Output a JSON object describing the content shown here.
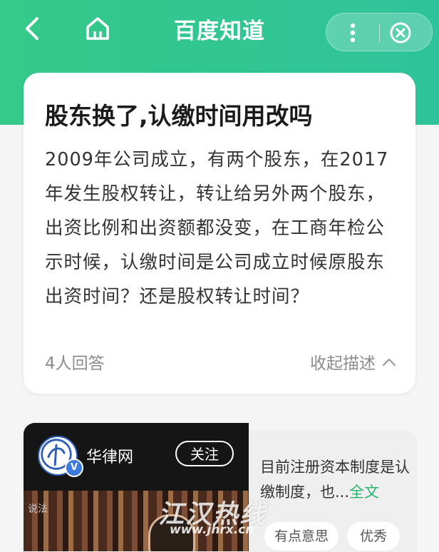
{
  "header": {
    "title": "百度知道",
    "back_icon": "chevron-left-icon",
    "home_icon": "home-icon",
    "more_icon": "more-vertical-icon",
    "close_icon": "close-circle-icon"
  },
  "question": {
    "title": "股东换了,认缴时间用改吗",
    "description": "2009年公司成立，有两个股东，在2017年发生股权转让，转让给另外两个股东，出资比例和出资额都没变，在工商年检公示时候，认缴时间是公司成立时候原股东出资时间？还是股权转让时间？",
    "answer_count": "4人回答",
    "collapse_label": "收起描述"
  },
  "video": {
    "source_name": "华律网",
    "follow_label": "关注",
    "verified_badge": "V",
    "shelf_label": "说法"
  },
  "answer_preview": {
    "text": "目前注册资本制度是认缴制度，也...",
    "full_link": "全文",
    "tags": [
      "有点意思",
      "优秀"
    ]
  },
  "watermark": {
    "brand": "江汉热线",
    "url": "www.jhrx.cn"
  },
  "colors": {
    "header_green": "#35c98a",
    "link_green": "#26b36e"
  }
}
